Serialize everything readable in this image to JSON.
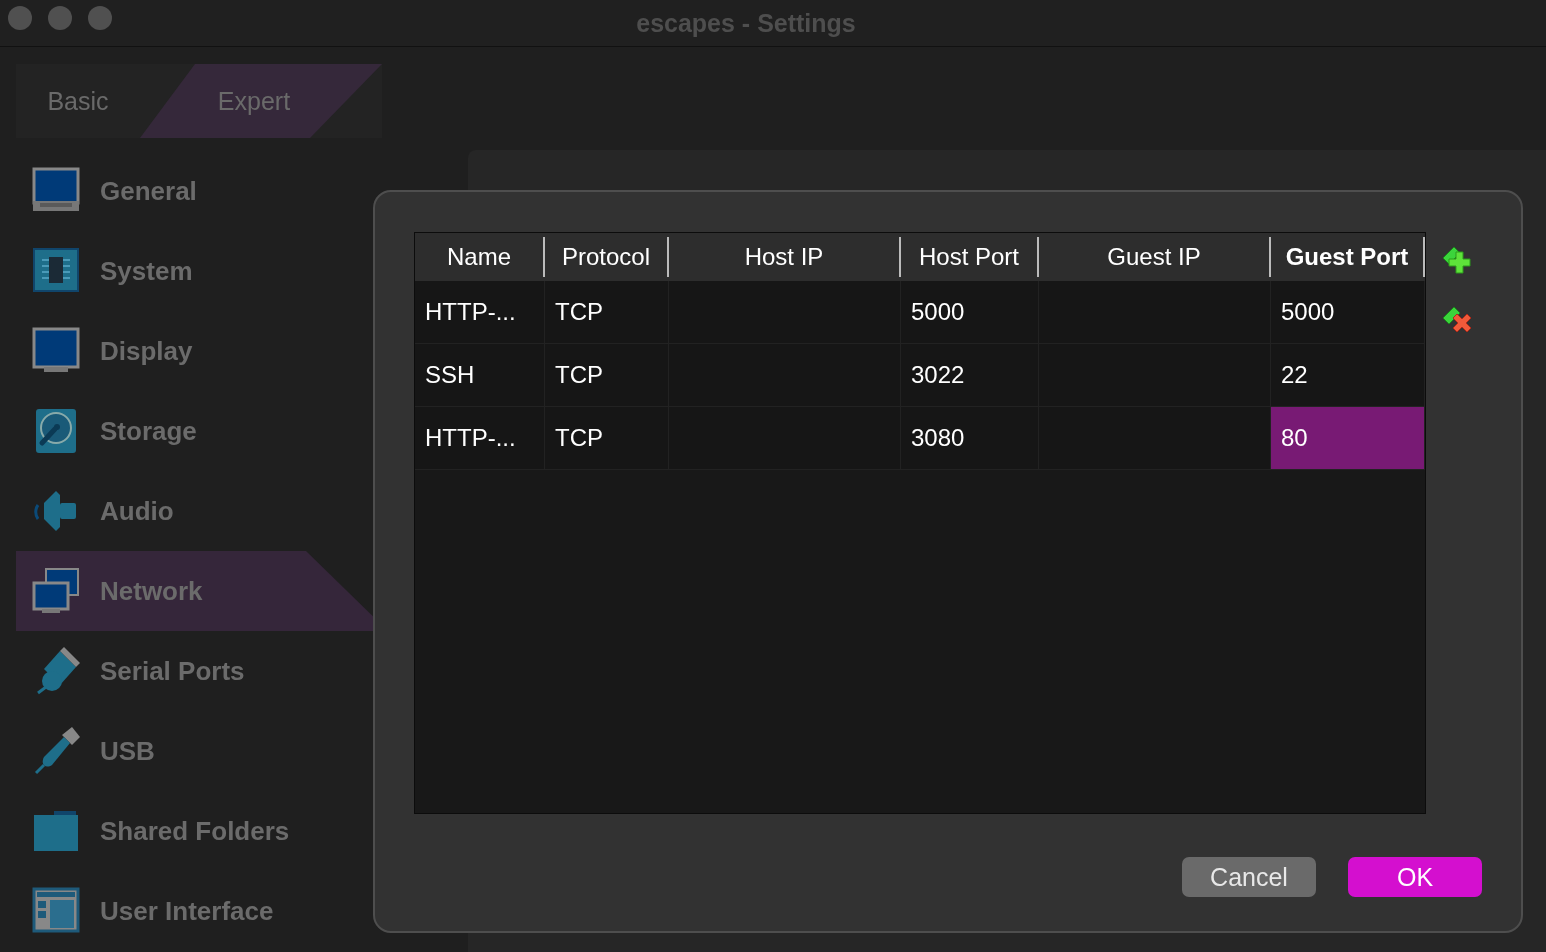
{
  "window": {
    "title": "escapes - Settings"
  },
  "tabs": [
    {
      "label": "Basic",
      "selected": false
    },
    {
      "label": "Expert",
      "selected": true
    }
  ],
  "sidebar": {
    "items": [
      {
        "label": "General",
        "selected": false
      },
      {
        "label": "System",
        "selected": false
      },
      {
        "label": "Display",
        "selected": false
      },
      {
        "label": "Storage",
        "selected": false
      },
      {
        "label": "Audio",
        "selected": false
      },
      {
        "label": "Network",
        "selected": true
      },
      {
        "label": "Serial Ports",
        "selected": false
      },
      {
        "label": "USB",
        "selected": false
      },
      {
        "label": "Shared Folders",
        "selected": false
      },
      {
        "label": "User Interface",
        "selected": false
      }
    ]
  },
  "dialog": {
    "table": {
      "columns": [
        {
          "label": "Name",
          "sorted": false
        },
        {
          "label": "Protocol",
          "sorted": false
        },
        {
          "label": "Host IP",
          "sorted": false
        },
        {
          "label": "Host Port",
          "sorted": false
        },
        {
          "label": "Guest IP",
          "sorted": false
        },
        {
          "label": "Guest Port",
          "sorted": true
        }
      ],
      "rows": [
        {
          "cells": [
            {
              "text": "HTTP-...",
              "selected": false
            },
            {
              "text": "TCP",
              "selected": false
            },
            {
              "selected": false
            },
            {
              "text": "5000",
              "selected": false
            },
            {
              "selected": false
            },
            {
              "text": "5000",
              "selected": false
            }
          ]
        },
        {
          "cells": [
            {
              "text": "SSH",
              "selected": false
            },
            {
              "text": "TCP",
              "selected": false
            },
            {
              "selected": false
            },
            {
              "text": "3022",
              "selected": false
            },
            {
              "selected": false
            },
            {
              "text": "22",
              "selected": false
            }
          ]
        },
        {
          "cells": [
            {
              "text": "HTTP-...",
              "selected": false
            },
            {
              "text": "TCP",
              "selected": false
            },
            {
              "selected": false
            },
            {
              "text": "3080",
              "selected": false
            },
            {
              "selected": false
            },
            {
              "text": "80",
              "selected": true
            }
          ]
        }
      ]
    },
    "buttons": [
      {
        "label": "Cancel",
        "kind": "secondary"
      },
      {
        "label": "OK",
        "kind": "primary"
      }
    ]
  }
}
